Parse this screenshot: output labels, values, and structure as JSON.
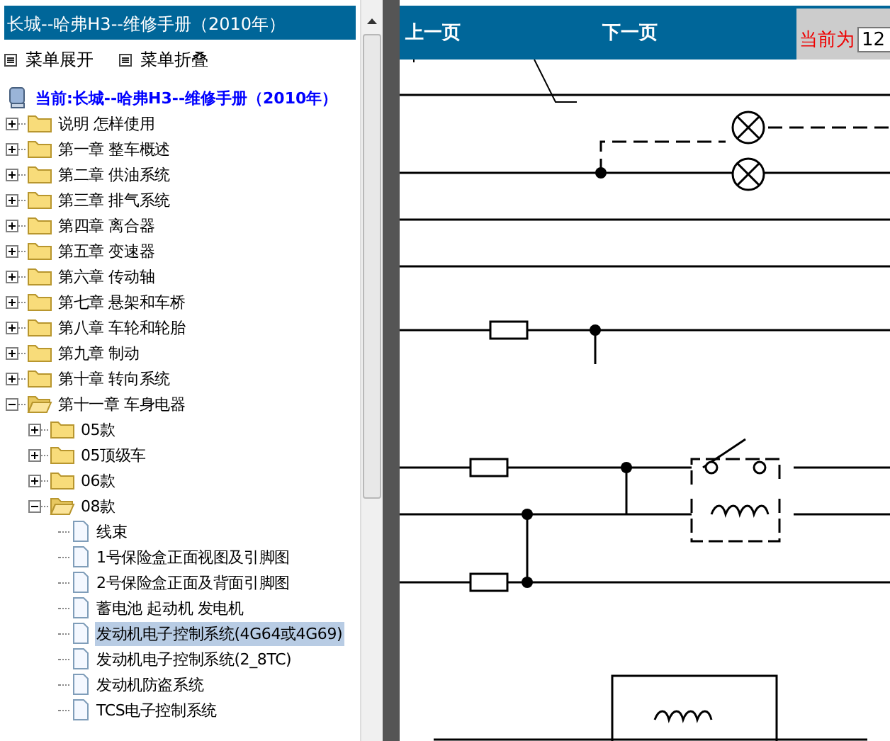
{
  "sidebar": {
    "title": "长城--哈弗H3--维修手册（2010年）",
    "actions": [
      {
        "label": "菜单展开"
      },
      {
        "label": "菜单折叠"
      }
    ],
    "tree": {
      "label": "当前:长城--哈弗H3--维修手册（2010年）",
      "children": [
        {
          "label": "说明 怎样使用",
          "kind": "folder",
          "expanded": false,
          "selected": false
        },
        {
          "label": "第一章 整车概述",
          "kind": "folder",
          "expanded": false,
          "selected": false
        },
        {
          "label": "第二章 供油系统",
          "kind": "folder",
          "expanded": false,
          "selected": false
        },
        {
          "label": "第三章 排气系统",
          "kind": "folder",
          "expanded": false,
          "selected": false
        },
        {
          "label": "第四章 离合器",
          "kind": "folder",
          "expanded": false,
          "selected": false
        },
        {
          "label": "第五章 变速器",
          "kind": "folder",
          "expanded": false,
          "selected": false
        },
        {
          "label": "第六章 传动轴",
          "kind": "folder",
          "expanded": false,
          "selected": false
        },
        {
          "label": "第七章 悬架和车桥",
          "kind": "folder",
          "expanded": false,
          "selected": false
        },
        {
          "label": "第八章 车轮和轮胎",
          "kind": "folder",
          "expanded": false,
          "selected": false
        },
        {
          "label": "第九章 制动",
          "kind": "folder",
          "expanded": false,
          "selected": false
        },
        {
          "label": "第十章 转向系统",
          "kind": "folder",
          "expanded": false,
          "selected": false
        },
        {
          "label": "第十一章 车身电器",
          "kind": "folder",
          "expanded": true,
          "selected": false,
          "children": [
            {
              "label": "05款",
              "kind": "folder",
              "expanded": false,
              "selected": false
            },
            {
              "label": "05顶级车",
              "kind": "folder",
              "expanded": false,
              "selected": false
            },
            {
              "label": "06款",
              "kind": "folder",
              "expanded": false,
              "selected": false
            },
            {
              "label": "08款",
              "kind": "folder",
              "expanded": true,
              "selected": false,
              "children": [
                {
                  "label": "线束",
                  "kind": "file",
                  "selected": false
                },
                {
                  "label": "1号保险盒正面视图及引脚图",
                  "kind": "file",
                  "selected": false
                },
                {
                  "label": "2号保险盒正面及背面引脚图",
                  "kind": "file",
                  "selected": false
                },
                {
                  "label": "蓄电池 起动机 发电机",
                  "kind": "file",
                  "selected": false
                },
                {
                  "label": "发动机电子控制系统(4G64或4G69)",
                  "kind": "file",
                  "selected": true
                },
                {
                  "label": "发动机电子控制系统(2_8TC)",
                  "kind": "file",
                  "selected": false
                },
                {
                  "label": "发动机防盗系统",
                  "kind": "file",
                  "selected": false
                },
                {
                  "label": "TCS电子控制系统",
                  "kind": "file",
                  "selected": false
                }
              ]
            }
          ]
        }
      ]
    }
  },
  "viewer": {
    "prev": "上一页",
    "next": "下一页",
    "current_label": "当前为",
    "current_page": "12"
  }
}
